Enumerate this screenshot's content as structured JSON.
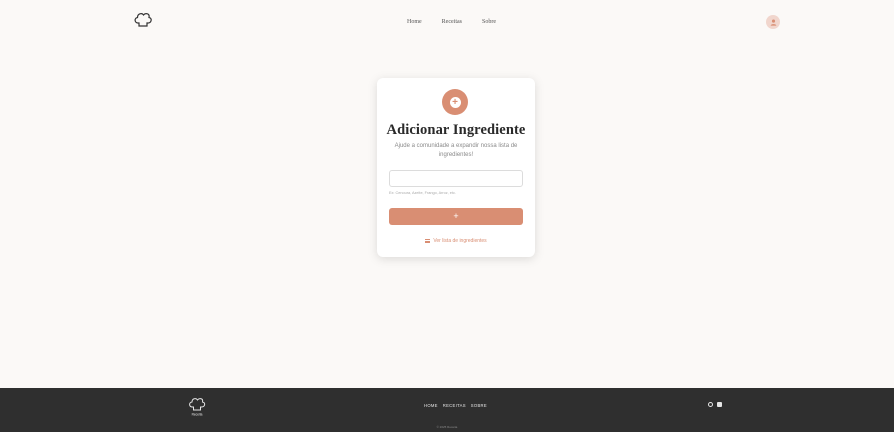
{
  "header": {
    "logo_icon": "chef-hat-icon",
    "nav": [
      "Home",
      "Receitas",
      "Sobre"
    ],
    "avatar_icon": "user-icon"
  },
  "card": {
    "icon": "plus-circle-icon",
    "title": "Adicionar Ingrediente",
    "subtitle": "Ajude a comunidade a expandir nossa lista de ingredientes!",
    "input_value": "",
    "hint": "Ex: Cenoura, Azeite, Frango, Arroz, etc.",
    "button_label": "+",
    "link_label": "Ver lista de ingredientes"
  },
  "footer": {
    "logo_icon": "chef-hat-icon",
    "logo_text": "Receita",
    "nav": [
      "HOME",
      "RECEITAS",
      "SOBRE"
    ],
    "copyright": "© 2025 Receita",
    "social": [
      "instagram-icon",
      "youtube-icon"
    ]
  },
  "colors": {
    "accent": "#d98e73",
    "background": "#fbf9f7",
    "footer": "#2f2f2f"
  }
}
